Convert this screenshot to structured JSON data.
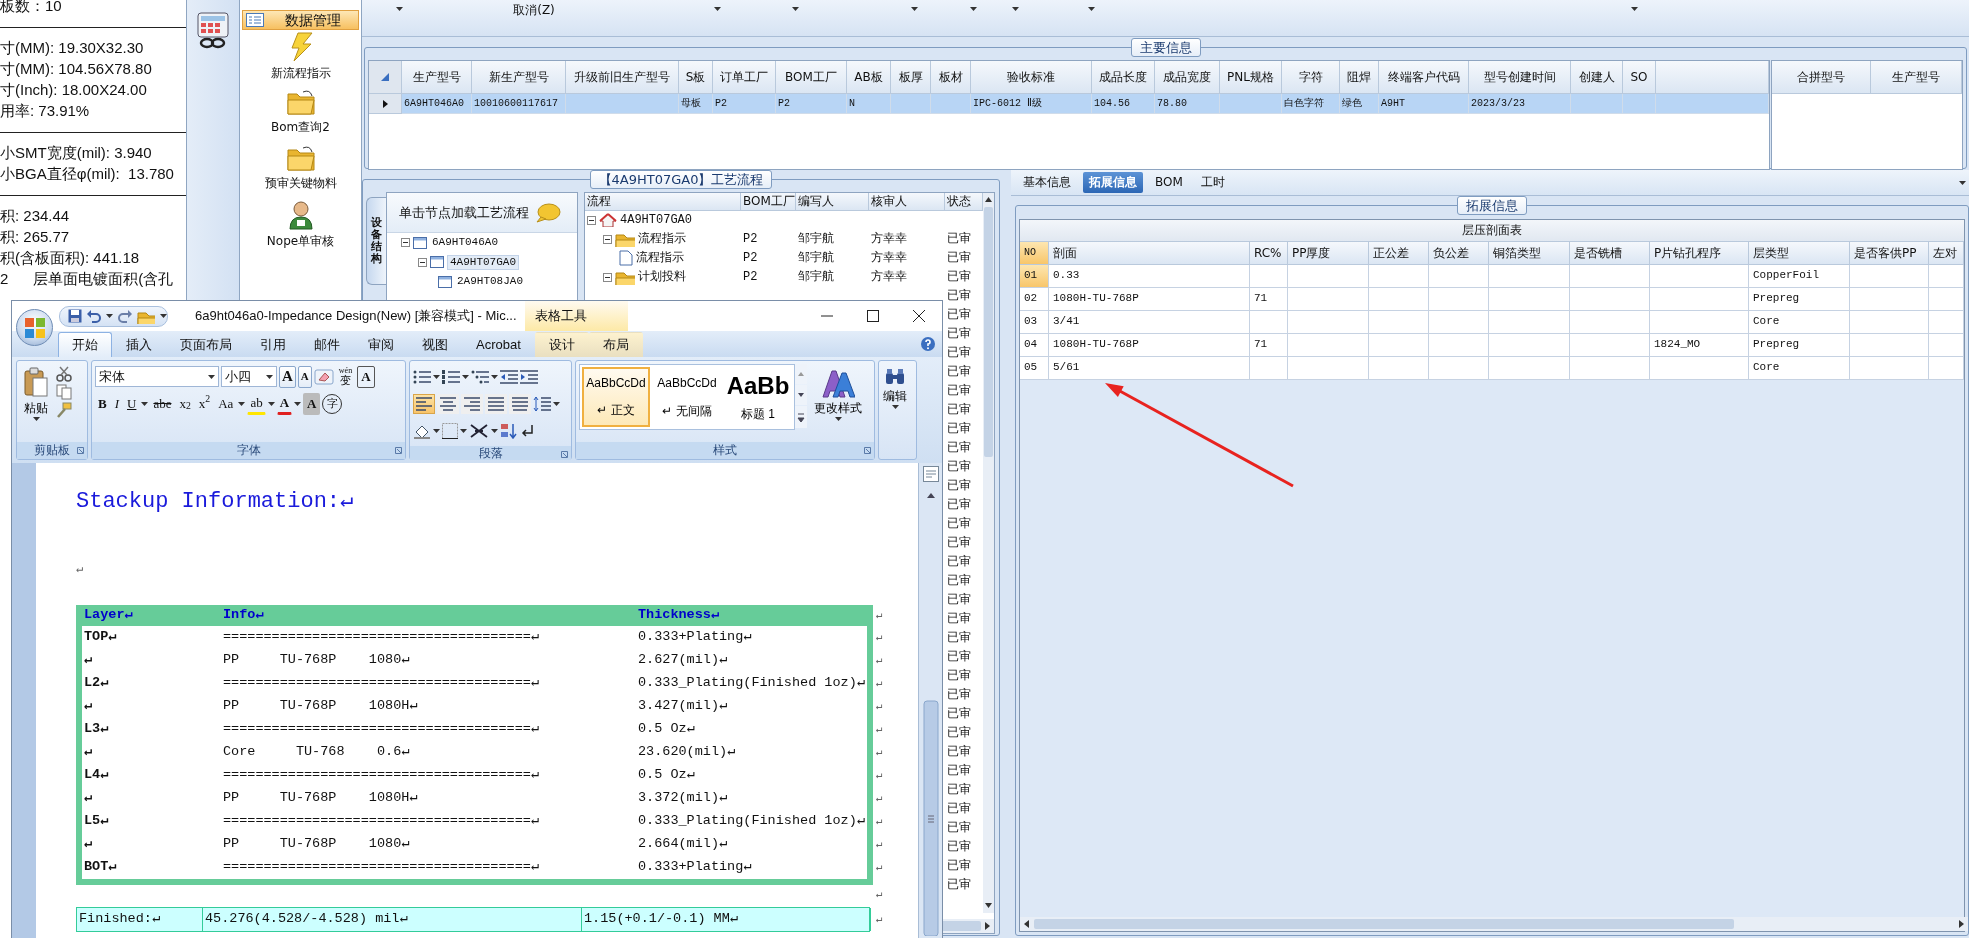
{
  "info_panel": {
    "lines": [
      {
        "kind": "text",
        "text": "板数：10"
      },
      {
        "kind": "rule"
      },
      {
        "kind": "text",
        "text": "寸(MM): 19.30X32.30"
      },
      {
        "kind": "text",
        "text": "寸(MM): 104.56X78.80"
      },
      {
        "kind": "text",
        "text": "寸(Inch): 18.00X24.00"
      },
      {
        "kind": "text",
        "text": "用率: 73.91%"
      },
      {
        "kind": "rule"
      },
      {
        "kind": "text",
        "text": "小SMT宽度(mil): 3.940"
      },
      {
        "kind": "text",
        "text": "小BGA直径φ(mil):  13.780"
      },
      {
        "kind": "rule"
      },
      {
        "kind": "text",
        "text": "积: 234.44"
      },
      {
        "kind": "text",
        "text": "积: 265.77"
      },
      {
        "kind": "text",
        "text": "积(含板面积): 441.18"
      },
      {
        "kind": "text",
        "text": "2      层单面电镀面积(含孔"
      }
    ]
  },
  "nav": {
    "header": "数据管理",
    "items": [
      {
        "label": "新流程指示"
      },
      {
        "label": "Bom查询2"
      },
      {
        "label": "预审关键物料"
      },
      {
        "label": "Nope单审核"
      }
    ]
  },
  "toolbar": {
    "cancel": "取消(Z)"
  },
  "main_info": {
    "title": "主要信息",
    "columns": [
      "生产型号",
      "新生产型号",
      "升级前旧生产型号",
      "S板",
      "订单工厂",
      "BOM工厂",
      "AB板",
      "板厚",
      "板材",
      "验收标准",
      "成品长度",
      "成品宽度",
      "PNL规格",
      "字符",
      "阻焊",
      "终端客户代码",
      "型号创建时间",
      "创建人",
      "SO"
    ],
    "rows": [
      {
        "selected": true,
        "cells": [
          "6A9HT046A0",
          "10010600117617",
          "",
          "母板",
          "P2",
          "P2",
          "N",
          "",
          "",
          "IPC-6012 Ⅱ级",
          "104.56",
          "78.80",
          "",
          "白色字符",
          "绿色",
          "A9HT",
          "2023/3/23",
          "",
          ""
        ]
      }
    ]
  },
  "merge_grid": {
    "columns": [
      "合拼型号",
      "生产型号"
    ]
  },
  "process": {
    "title": "【4A9HT07GA0】工艺流程",
    "side_tab": "设备结构",
    "tree_hint": "单击节点加载工艺流程",
    "tree": [
      {
        "label": "6A9HT046A0",
        "expanded": true,
        "selected": false,
        "children": [
          {
            "label": "4A9HT07GA0",
            "expanded": true,
            "selected": true,
            "children": [
              {
                "label": "2A9HT08JA0",
                "selected": false
              }
            ]
          }
        ]
      }
    ],
    "columns": [
      "流程",
      "BOM工厂",
      "编写人",
      "核审人",
      "状态"
    ],
    "flows": [
      {
        "flow": "4A9HT07GA0",
        "expanded": true,
        "children": [
          {
            "flow": "流程指示",
            "bom": "P2",
            "writer": "邹宇航",
            "reviewer": "方幸幸",
            "status": "已审",
            "expanded": true,
            "children": [
              {
                "flow": "流程指示",
                "bom": "P2",
                "writer": "邹宇航",
                "reviewer": "方幸幸",
                "status": "已审"
              }
            ]
          },
          {
            "flow": "计划投料",
            "bom": "P2",
            "writer": "邹宇航",
            "reviewer": "方幸幸",
            "status": "已审",
            "expanded": true
          }
        ]
      }
    ],
    "covered_rows": [
      {
        "status": "已审"
      },
      {
        "status": "已审"
      },
      {
        "status": "已审"
      },
      {
        "status": "已审"
      },
      {
        "status": "已审"
      },
      {
        "status": "已审"
      },
      {
        "status": "已审"
      },
      {
        "status": "已审"
      },
      {
        "status": "已审"
      },
      {
        "status": "已审"
      },
      {
        "status": "已审"
      },
      {
        "status": "已审"
      },
      {
        "status": "已审"
      },
      {
        "status": "已审"
      },
      {
        "status": "已审"
      },
      {
        "status": "已审"
      },
      {
        "status": "已审"
      },
      {
        "status": "已审"
      },
      {
        "status": "已审"
      },
      {
        "status": "已审"
      },
      {
        "status": "已审"
      },
      {
        "status": "已审"
      },
      {
        "status": "已审"
      },
      {
        "status": "已审"
      },
      {
        "status": "已审"
      },
      {
        "status": "已审"
      },
      {
        "status": "已审"
      },
      {
        "status": "已审"
      },
      {
        "status": "已审"
      },
      {
        "status": "已审"
      },
      {
        "status": "已审"
      },
      {
        "status": "已审"
      }
    ]
  },
  "ext": {
    "tabs": [
      {
        "label": "基本信息",
        "selected": false
      },
      {
        "label": "拓展信息",
        "selected": true
      },
      {
        "label": "BOM",
        "selected": false
      },
      {
        "label": "工时",
        "selected": false
      }
    ],
    "title": "拓展信息",
    "table": {
      "caption": "层压剖面表",
      "columns": [
        "NO",
        "剖面",
        "RC%",
        "PP厚度",
        "正公差",
        "负公差",
        "铜箔类型",
        "是否铣槽",
        "P片钻孔程序",
        "层类型",
        "是否客供PP",
        "左对"
      ],
      "rows": [
        {
          "selected": true,
          "cells": [
            "01",
            "0.33",
            "",
            "",
            "",
            "",
            "",
            "",
            "",
            "CopperFoil",
            "",
            ""
          ]
        },
        {
          "selected": false,
          "cells": [
            "02",
            "1080H-TU-768P",
            "71",
            "",
            "",
            "",
            "",
            "",
            "",
            "Prepreg",
            "",
            ""
          ]
        },
        {
          "selected": false,
          "cells": [
            "03",
            "3/41",
            "",
            "",
            "",
            "",
            "",
            "",
            "",
            "Core",
            "",
            ""
          ]
        },
        {
          "selected": false,
          "cells": [
            "04",
            "1080H-TU-768P",
            "71",
            "",
            "",
            "",
            "",
            "",
            "1824_MO",
            "Prepreg",
            "",
            ""
          ]
        },
        {
          "selected": false,
          "cells": [
            "05",
            "5/61",
            "",
            "",
            "",
            "",
            "",
            "",
            "",
            "Core",
            "",
            ""
          ]
        }
      ]
    }
  },
  "annotations": [
    {
      "kind": "arrow"
    }
  ],
  "word": {
    "title": "6a9ht046a0-Impedance Design(New) [兼容模式] - Mic...",
    "context_tab": "表格工具",
    "tabs": [
      {
        "label": "开始",
        "selected": true,
        "kind": "main"
      },
      {
        "label": "插入",
        "selected": false,
        "kind": "main"
      },
      {
        "label": "页面布局",
        "selected": false,
        "kind": "main"
      },
      {
        "label": "引用",
        "selected": false,
        "kind": "main"
      },
      {
        "label": "邮件",
        "selected": false,
        "kind": "main"
      },
      {
        "label": "审阅",
        "selected": false,
        "kind": "main"
      },
      {
        "label": "视图",
        "selected": false,
        "kind": "main"
      },
      {
        "label": "Acrobat",
        "selected": false,
        "kind": "main"
      },
      {
        "label": "设计",
        "selected": false,
        "kind": "context"
      },
      {
        "label": "布局",
        "selected": false,
        "kind": "context"
      }
    ],
    "clipboard": {
      "paste": "粘贴",
      "label": "剪贴板"
    },
    "font": {
      "face": "宋体",
      "size": "小四",
      "label": "字体",
      "row1": [
        {
          "kind": "grow",
          "label": "A"
        },
        {
          "kind": "shrink",
          "label": "A"
        },
        {
          "kind": "ruby",
          "label": "变",
          "ruby": "wén"
        },
        {
          "kind": "boxed",
          "label": "A"
        }
      ],
      "row2": [
        {
          "kind": "bold",
          "label": "B"
        },
        {
          "kind": "italic",
          "label": "I"
        },
        {
          "kind": "underline",
          "label": "U"
        },
        {
          "kind": "strike",
          "label": "abe"
        },
        {
          "kind": "script",
          "label": "x$_{2}$"
        },
        {
          "kind": "script",
          "label": "x$^{2}$"
        },
        {
          "kind": "case",
          "label": "Aa"
        },
        {
          "kind": "highlight",
          "label": "ab"
        },
        {
          "kind": "color",
          "label": "A"
        },
        {
          "kind": "shade",
          "label": "A"
        },
        {
          "kind": "circle",
          "label": "字"
        }
      ]
    },
    "paragraph": {
      "label": "段落",
      "align": [
        {
          "selected": true
        },
        {
          "selected": false
        },
        {
          "selected": false
        },
        {
          "selected": false
        },
        {
          "selected": false
        }
      ]
    },
    "styles": {
      "label": "样式",
      "change": "更改样式",
      "items": [
        {
          "preview": "AaBbCcDd",
          "label": "↵ 正文",
          "selected": true,
          "kind": "normal"
        },
        {
          "preview": "AaBbCcDd",
          "label": "↵ 无间隔",
          "selected": false,
          "kind": "normal"
        },
        {
          "preview": "AaBb",
          "label": "标题 1",
          "selected": false,
          "kind": "heading"
        }
      ]
    },
    "editing": {
      "label": "编辑"
    },
    "document": {
      "heading": "Stackup Information:↵",
      "empty_paragraph": "↵",
      "stackup": {
        "columns": [
          "Layer↵",
          "Info↵",
          "Thickness↵"
        ],
        "header_end": "↵",
        "rows": [
          {
            "cells": [
              "TOP↵",
              "======================================↵",
              "0.333+Plating↵"
            ],
            "end": "↵"
          },
          {
            "cells": [
              "↵",
              "PP     TU-768P    1080↵",
              "2.627(mil)↵"
            ],
            "end": "↵"
          },
          {
            "cells": [
              "L2↵",
              "======================================↵",
              "0.333_Plating(Finished 1oz)↵"
            ],
            "end": "↵"
          },
          {
            "cells": [
              "↵",
              "PP     TU-768P    1080H↵",
              "3.427(mil)↵"
            ],
            "end": "↵"
          },
          {
            "cells": [
              "L3↵",
              "======================================↵",
              "0.5 Oz↵"
            ],
            "end": "↵"
          },
          {
            "cells": [
              "↵",
              "Core     TU-768    0.6↵",
              "23.620(mil)↵"
            ],
            "end": "↵"
          },
          {
            "cells": [
              "L4↵",
              "======================================↵",
              "0.5 Oz↵"
            ],
            "end": "↵"
          },
          {
            "cells": [
              "↵",
              "PP     TU-768P    1080H↵",
              "3.372(mil)↵"
            ],
            "end": "↵"
          },
          {
            "cells": [
              "L5↵",
              "======================================↵",
              "0.333_Plating(Finished 1oz)↵"
            ],
            "end": "↵"
          },
          {
            "cells": [
              "↵",
              "PP     TU-768P    1080↵",
              "2.664(mil)↵"
            ],
            "end": "↵"
          },
          {
            "cells": [
              "BOT↵",
              "======================================↵",
              "0.333+Plating↵"
            ],
            "end": "↵"
          }
        ]
      },
      "after_table": "↵",
      "finished": {
        "cells": [
          "Finished:↵",
          "45.276(4.528/-4.528) mil↵",
          "1.15(+0.1/-0.1) MM↵"
        ],
        "end": "↵"
      }
    }
  }
}
